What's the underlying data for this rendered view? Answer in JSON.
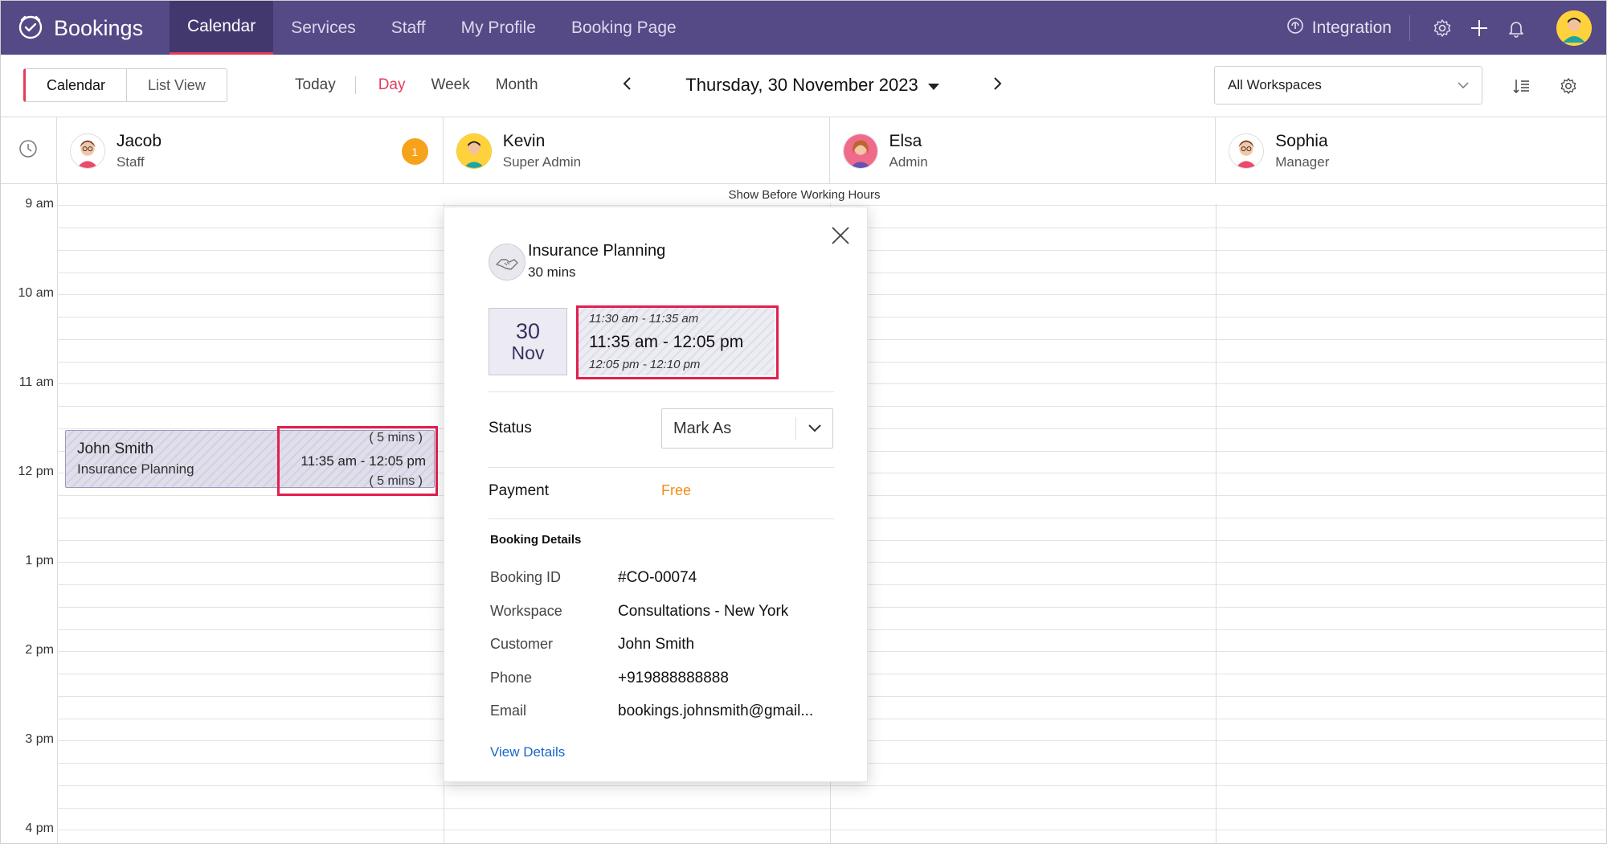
{
  "app": {
    "name": "Bookings"
  },
  "nav": {
    "items": [
      {
        "label": "Calendar",
        "active": true
      },
      {
        "label": "Services",
        "active": false
      },
      {
        "label": "Staff",
        "active": false
      },
      {
        "label": "My Profile",
        "active": false
      },
      {
        "label": "Booking Page",
        "active": false
      }
    ]
  },
  "topbar": {
    "integration_label": "Integration"
  },
  "toolbar": {
    "calendar_label": "Calendar",
    "list_view_label": "List View",
    "today_label": "Today",
    "day_label": "Day",
    "week_label": "Week",
    "month_label": "Month",
    "current_date": "Thursday, 30 November 2023",
    "workspace_value": "All Workspaces"
  },
  "staff": [
    {
      "name": "Jacob",
      "role": "Staff",
      "badge": "1"
    },
    {
      "name": "Kevin",
      "role": "Super Admin"
    },
    {
      "name": "Elsa",
      "role": "Admin"
    },
    {
      "name": "Sophia",
      "role": "Manager"
    }
  ],
  "grid": {
    "show_before_label": "Show Before Working Hours",
    "times": [
      "9 am",
      "10 am",
      "11 am",
      "12 pm",
      "1 pm",
      "2 pm",
      "3 pm",
      "4 pm"
    ]
  },
  "booking": {
    "customer": "John Smith",
    "service": "Insurance Planning",
    "buffer_before": "( 5 mins )",
    "time": "11:35 am - 12:05 pm",
    "buffer_after": "( 5 mins )"
  },
  "popup": {
    "service_title": "Insurance Planning",
    "duration": "30 mins",
    "date_day": "30",
    "date_month": "Nov",
    "buffer_before": "11:30 am - 11:35 am",
    "slot_time": "11:35 am - 12:05 pm",
    "buffer_after": "12:05 pm - 12:10 pm",
    "status_label": "Status",
    "status_value": "Mark As",
    "payment_label": "Payment",
    "payment_value": "Free",
    "details_title": "Booking Details",
    "details": [
      {
        "key": "Booking ID",
        "value": "#CO-00074"
      },
      {
        "key": "Workspace",
        "value": "Consultations - New York"
      },
      {
        "key": "Customer",
        "value": "John Smith"
      },
      {
        "key": "Phone",
        "value": "+919888888888"
      },
      {
        "key": "Email",
        "value": "bookings.johnsmith@gmail..."
      }
    ],
    "view_details_label": "View Details"
  },
  "colors": {
    "header": "#554a86",
    "accent": "#e63a5a",
    "payment": "#f28c1a",
    "link": "#1a66c9",
    "badge": "#f7a21b",
    "highlight": "#e21f4f"
  }
}
